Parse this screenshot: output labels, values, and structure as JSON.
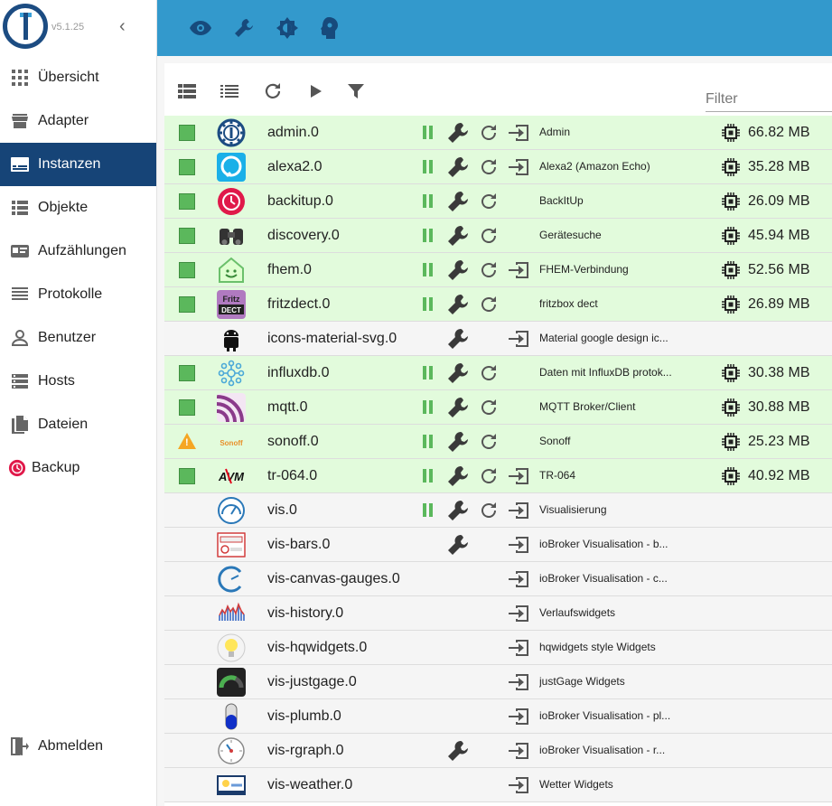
{
  "app": {
    "version": "v5.1.25"
  },
  "colors": {
    "topbar": "#3399cc",
    "nav_active": "#164477",
    "row_running": "#e2fbdc",
    "row_stopped": "#f5f5f5",
    "status_green": "#5bb85c",
    "warning": "#f5a623"
  },
  "sidebar": {
    "items": [
      {
        "label": "Übersicht",
        "icon": "apps-grid-icon"
      },
      {
        "label": "Adapter",
        "icon": "store-icon"
      },
      {
        "label": "Instanzen",
        "icon": "instances-icon",
        "active": true
      },
      {
        "label": "Objekte",
        "icon": "list-icon"
      },
      {
        "label": "Aufzählungen",
        "icon": "enum-card-icon"
      },
      {
        "label": "Protokolle",
        "icon": "log-lines-icon"
      },
      {
        "label": "Benutzer",
        "icon": "user-icon"
      },
      {
        "label": "Hosts",
        "icon": "server-icon"
      },
      {
        "label": "Dateien",
        "icon": "file-icon"
      },
      {
        "label": "Backup",
        "icon": "backup-clock-icon"
      }
    ],
    "logout_label": "Abmelden"
  },
  "topbar": {
    "buttons": [
      "eye-icon",
      "wrench-icon",
      "brightness-icon",
      "expert-head-icon"
    ]
  },
  "toolbar": {
    "buttons": [
      "table-view-icon",
      "list-view-icon",
      "refresh-icon",
      "play-icon",
      "filter-icon"
    ],
    "filter_placeholder": "Filter"
  },
  "instances": [
    {
      "name": "admin.0",
      "title": "Admin",
      "memory": "66.82 MB",
      "status": "green",
      "running": true,
      "pause": true,
      "settings": true,
      "restart": true,
      "open": true,
      "icon": "admin",
      "iconbg": "#1c4c82"
    },
    {
      "name": "alexa2.0",
      "title": "Alexa2 (Amazon Echo)",
      "memory": "35.28 MB",
      "status": "green",
      "running": true,
      "pause": true,
      "settings": true,
      "restart": true,
      "open": true,
      "icon": "alexa",
      "iconbg": "#1ab0e8"
    },
    {
      "name": "backitup.0",
      "title": "BackItUp",
      "memory": "26.09 MB",
      "status": "green",
      "running": true,
      "pause": true,
      "settings": true,
      "restart": true,
      "open": false,
      "icon": "backitup",
      "iconbg": "#e0194a"
    },
    {
      "name": "discovery.0",
      "title": "Gerätesuche",
      "memory": "45.94 MB",
      "status": "green",
      "running": true,
      "pause": true,
      "settings": true,
      "restart": true,
      "open": false,
      "icon": "discovery",
      "iconbg": "#ffffff"
    },
    {
      "name": "fhem.0",
      "title": "FHEM-Verbindung",
      "memory": "52.56 MB",
      "status": "green",
      "running": true,
      "pause": true,
      "settings": true,
      "restart": true,
      "open": true,
      "icon": "fhem",
      "iconbg": "#eaffea"
    },
    {
      "name": "fritzdect.0",
      "title": "fritzbox dect",
      "memory": "26.89 MB",
      "status": "green",
      "running": true,
      "pause": true,
      "settings": true,
      "restart": true,
      "open": false,
      "icon": "fritz",
      "iconbg": "#b07ac0"
    },
    {
      "name": "icons-material-svg.0",
      "title": "Material google design ic...",
      "memory": "",
      "status": "none",
      "running": false,
      "pause": false,
      "settings": true,
      "restart": false,
      "open": true,
      "icon": "android",
      "iconbg": "#ffffff"
    },
    {
      "name": "influxdb.0",
      "title": "Daten mit InfluxDB protok...",
      "memory": "30.38 MB",
      "status": "green",
      "running": true,
      "pause": true,
      "settings": true,
      "restart": true,
      "open": false,
      "icon": "influx",
      "iconbg": "#ffffff"
    },
    {
      "name": "mqtt.0",
      "title": "MQTT Broker/Client",
      "memory": "30.88 MB",
      "status": "green",
      "running": true,
      "pause": true,
      "settings": true,
      "restart": true,
      "open": false,
      "icon": "mqtt",
      "iconbg": "#8a3a8a"
    },
    {
      "name": "sonoff.0",
      "title": "Sonoff",
      "memory": "25.23 MB",
      "status": "warning",
      "running": true,
      "pause": true,
      "settings": true,
      "restart": true,
      "open": false,
      "icon": "sonoff",
      "iconbg": "#ffffff"
    },
    {
      "name": "tr-064.0",
      "title": "TR-064",
      "memory": "40.92 MB",
      "status": "green",
      "running": true,
      "pause": true,
      "settings": true,
      "restart": true,
      "open": true,
      "icon": "avm",
      "iconbg": "#ffffff"
    },
    {
      "name": "vis.0",
      "title": "Visualisierung",
      "memory": "",
      "status": "none",
      "running": false,
      "pause": true,
      "settings": true,
      "restart": true,
      "open": true,
      "icon": "vis",
      "iconbg": "#ffffff"
    },
    {
      "name": "vis-bars.0",
      "title": "ioBroker Visualisation - b...",
      "memory": "",
      "status": "none",
      "running": false,
      "pause": false,
      "settings": true,
      "restart": false,
      "open": true,
      "icon": "visbars",
      "iconbg": "#ffffff"
    },
    {
      "name": "vis-canvas-gauges.0",
      "title": "ioBroker Visualisation - c...",
      "memory": "",
      "status": "none",
      "running": false,
      "pause": false,
      "settings": false,
      "restart": false,
      "open": true,
      "icon": "gauge",
      "iconbg": "#ffffff"
    },
    {
      "name": "vis-history.0",
      "title": "Verlaufswidgets",
      "memory": "",
      "status": "none",
      "running": false,
      "pause": false,
      "settings": false,
      "restart": false,
      "open": true,
      "icon": "history",
      "iconbg": "#ffffff"
    },
    {
      "name": "vis-hqwidgets.0",
      "title": "hqwidgets style Widgets",
      "memory": "",
      "status": "none",
      "running": false,
      "pause": false,
      "settings": false,
      "restart": false,
      "open": true,
      "icon": "bulb",
      "iconbg": "#ffffff"
    },
    {
      "name": "vis-justgage.0",
      "title": "justGage Widgets",
      "memory": "",
      "status": "none",
      "running": false,
      "pause": false,
      "settings": false,
      "restart": false,
      "open": true,
      "icon": "justgage",
      "iconbg": "#222222"
    },
    {
      "name": "vis-plumb.0",
      "title": "ioBroker Visualisation - pl...",
      "memory": "",
      "status": "none",
      "running": false,
      "pause": false,
      "settings": false,
      "restart": false,
      "open": true,
      "icon": "plumb",
      "iconbg": "#ffffff"
    },
    {
      "name": "vis-rgraph.0",
      "title": "ioBroker Visualisation - r...",
      "memory": "",
      "status": "none",
      "running": false,
      "pause": false,
      "settings": true,
      "restart": false,
      "open": true,
      "icon": "rgraph",
      "iconbg": "#ffffff"
    },
    {
      "name": "vis-weather.0",
      "title": "Wetter Widgets",
      "memory": "",
      "status": "none",
      "running": false,
      "pause": false,
      "settings": false,
      "restart": false,
      "open": true,
      "icon": "weather",
      "iconbg": "#ffffff"
    }
  ]
}
